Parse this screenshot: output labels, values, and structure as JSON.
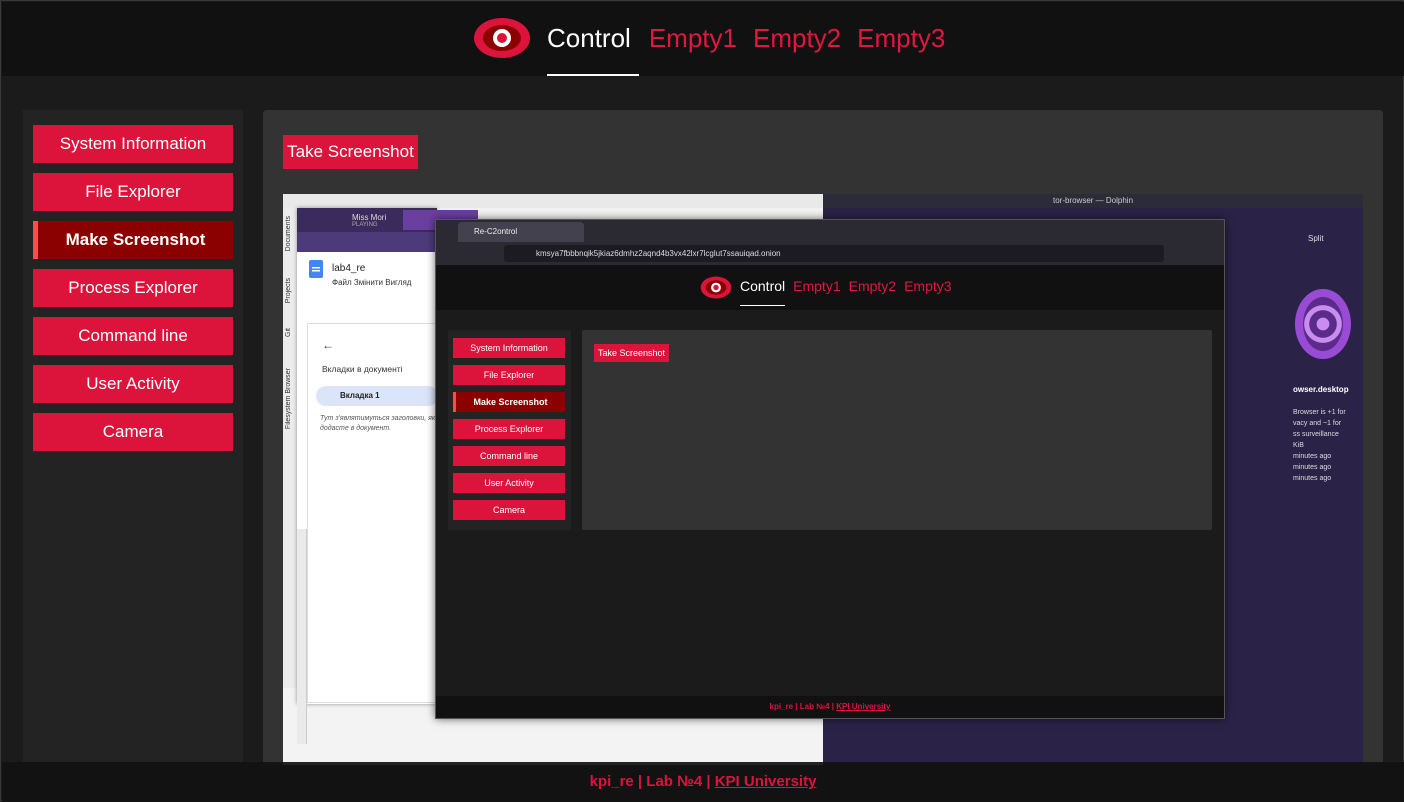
{
  "header": {
    "tabs": [
      {
        "label": "Control"
      },
      {
        "label": "Empty1"
      },
      {
        "label": "Empty2"
      },
      {
        "label": "Empty3"
      }
    ],
    "active_tab": "Control",
    "accent_color": "#dc143c"
  },
  "sidebar": {
    "items": [
      {
        "label": "System Information"
      },
      {
        "label": "File Explorer"
      },
      {
        "label": "Make Screenshot"
      },
      {
        "label": "Process Explorer"
      },
      {
        "label": "Command line"
      },
      {
        "label": "User Activity"
      },
      {
        "label": "Camera"
      }
    ],
    "active_item": "Make Screenshot"
  },
  "main": {
    "take_screenshot_label": "Take Screenshot"
  },
  "screenshot": {
    "left_window": {
      "vertical_tabs": [
        "Documents",
        "Projects",
        "Git",
        "Filesystem Browser"
      ],
      "doc_tabs": [
        "Miss Mori",
        "PLAYING"
      ],
      "doc_title": "lab4_re",
      "doc_menu": "Файл  Змінити  Вигляд",
      "panel_heading": "Вкладки в документі",
      "panel_tab": "Вкладка 1",
      "panel_hint": "Тут з'являтимуться заголовки, як додасте в документ."
    },
    "dolphin": {
      "title": "tor-browser — Dolphin",
      "split_label": "Split",
      "file_name": "owser.desktop",
      "info_lines": [
        "Browser is +1 for",
        "vacy and ~1 for",
        "ss surveillance",
        "KiB",
        "minutes ago",
        "minutes ago",
        "minutes ago"
      ]
    },
    "browser": {
      "tab_title": "Re-C2ontrol",
      "url": "kmsya7fbbbnqik5jkiaz6dmhz2aqnd4b3vx42lxr7lcglut7ssauiqad.onion",
      "nav": [
        "Control",
        "Empty1",
        "Empty2",
        "Empty3"
      ],
      "sidebar": [
        "System Information",
        "File Explorer",
        "Make Screenshot",
        "Process Explorer",
        "Command line",
        "User Activity",
        "Camera"
      ],
      "take_screenshot_label": "Take Screenshot",
      "footer_text": "kpi_re | Lab №4 | ",
      "footer_link": "KPI University"
    }
  },
  "footer": {
    "text": "kpi_re | Lab №4 | ",
    "link": "KPI University"
  }
}
